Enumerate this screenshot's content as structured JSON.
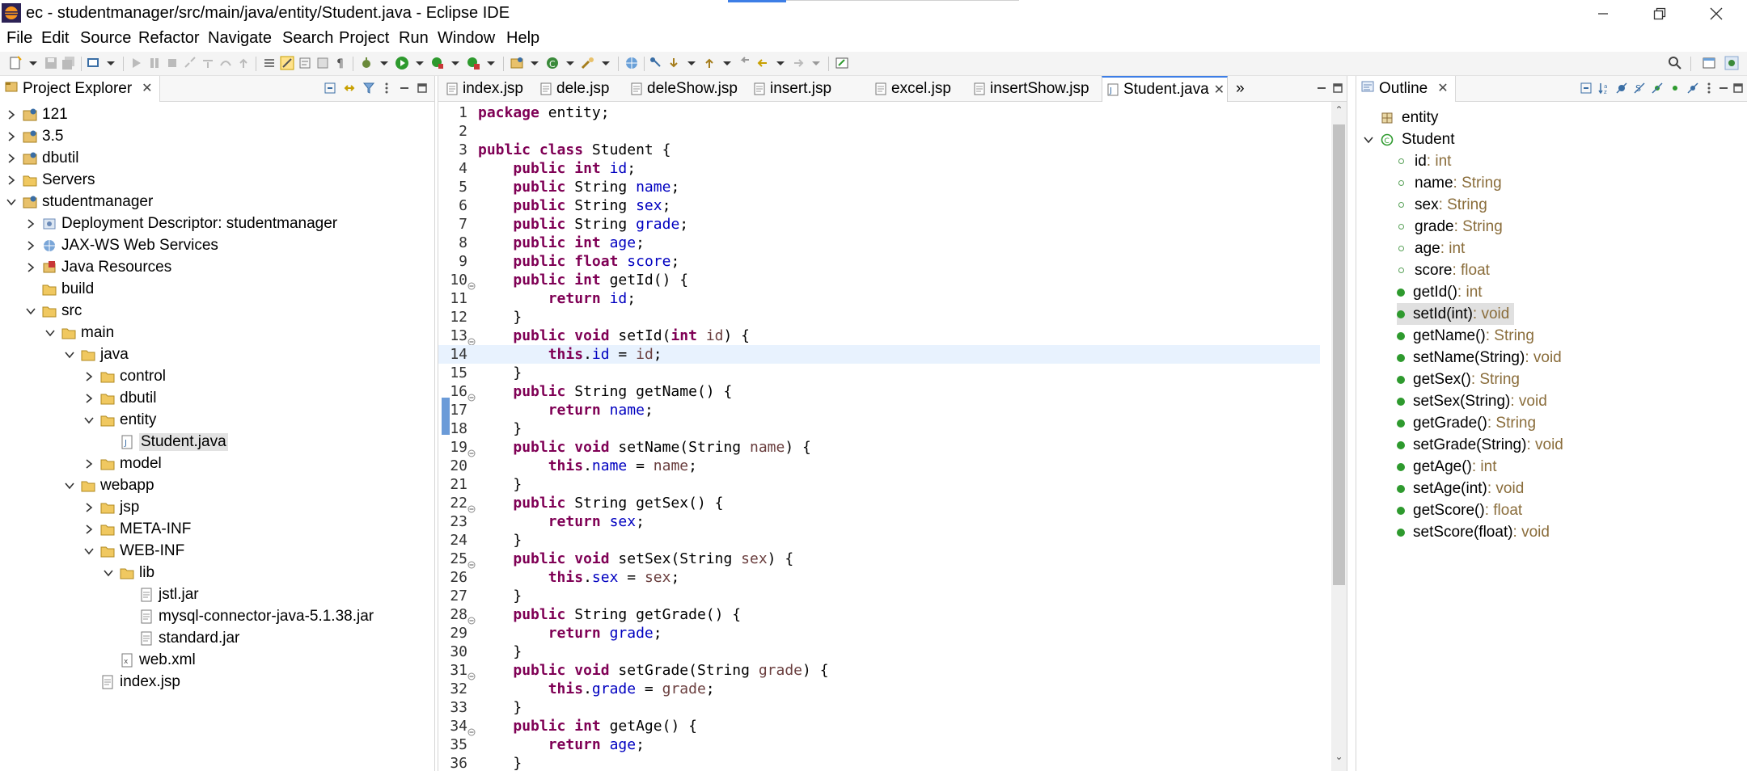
{
  "window": {
    "title": "ec - studentmanager/src/main/java/entity/Student.java - Eclipse IDE"
  },
  "menu": [
    "File",
    "Edit",
    "Source",
    "Refactor",
    "Navigate",
    "Search",
    "Project",
    "Run",
    "Window",
    "Help"
  ],
  "project_explorer": {
    "title": "Project Explorer",
    "items": [
      {
        "label": "121",
        "icon": "project-icon",
        "expanded": false
      },
      {
        "label": "3.5",
        "icon": "project-icon",
        "expanded": false
      },
      {
        "label": "dbutil",
        "icon": "project-icon",
        "expanded": false
      },
      {
        "label": "Servers",
        "icon": "folder-icon",
        "expanded": false
      },
      {
        "label": "studentmanager",
        "icon": "project-icon",
        "expanded": true
      },
      {
        "label": "Deployment Descriptor: studentmanager",
        "icon": "descriptor-icon",
        "expanded": false
      },
      {
        "label": "JAX-WS Web Services",
        "icon": "webservice-icon",
        "expanded": false
      },
      {
        "label": "Java Resources",
        "icon": "java-resources-icon",
        "expanded": false
      },
      {
        "label": "build",
        "icon": "folder-icon",
        "expanded": null
      },
      {
        "label": "src",
        "icon": "folder-icon",
        "expanded": true
      },
      {
        "label": "main",
        "icon": "folder-icon",
        "expanded": true
      },
      {
        "label": "java",
        "icon": "folder-icon",
        "expanded": true
      },
      {
        "label": "control",
        "icon": "folder-icon",
        "expanded": false
      },
      {
        "label": "dbutil",
        "icon": "folder-icon",
        "expanded": false
      },
      {
        "label": "entity",
        "icon": "folder-icon",
        "expanded": true
      },
      {
        "label": "Student.java",
        "icon": "java-file-icon",
        "expanded": null
      },
      {
        "label": "model",
        "icon": "folder-icon",
        "expanded": false
      },
      {
        "label": "webapp",
        "icon": "folder-icon",
        "expanded": true
      },
      {
        "label": "jsp",
        "icon": "folder-icon",
        "expanded": false
      },
      {
        "label": "META-INF",
        "icon": "folder-icon",
        "expanded": false
      },
      {
        "label": "WEB-INF",
        "icon": "folder-icon",
        "expanded": true
      },
      {
        "label": "lib",
        "icon": "folder-icon",
        "expanded": true
      },
      {
        "label": "jstl.jar",
        "icon": "jar-icon",
        "expanded": null
      },
      {
        "label": "mysql-connector-java-5.1.38.jar",
        "icon": "jar-icon",
        "expanded": null
      },
      {
        "label": "standard.jar",
        "icon": "jar-icon",
        "expanded": null
      },
      {
        "label": "web.xml",
        "icon": "xml-file-icon",
        "expanded": null
      },
      {
        "label": "index.jsp",
        "icon": "jsp-file-icon",
        "expanded": null
      }
    ]
  },
  "editor": {
    "tabs": [
      "index.jsp",
      "dele.jsp",
      "deleShow.jsp",
      "insert.jsp",
      "excel.jsp",
      "insertShow.jsp",
      "Student.java"
    ],
    "active_tab": "Student.java",
    "overflow_label": "»",
    "current_line": 14,
    "lines": [
      {
        "n": "1",
        "code": "package entity;"
      },
      {
        "n": "2",
        "code": ""
      },
      {
        "n": "3",
        "code": "public class Student {"
      },
      {
        "n": "4",
        "code": "    public int id;"
      },
      {
        "n": "5",
        "code": "    public String name;"
      },
      {
        "n": "6",
        "code": "    public String sex;"
      },
      {
        "n": "7",
        "code": "    public String grade;"
      },
      {
        "n": "8",
        "code": "    public int age;"
      },
      {
        "n": "9",
        "code": "    public float score;"
      },
      {
        "n": "10",
        "code": "    public int getId() {"
      },
      {
        "n": "11",
        "code": "        return id;"
      },
      {
        "n": "12",
        "code": "    }"
      },
      {
        "n": "13",
        "code": "    public void setId(int id) {"
      },
      {
        "n": "14",
        "code": "        this.id = id;"
      },
      {
        "n": "15",
        "code": "    }"
      },
      {
        "n": "16",
        "code": "    public String getName() {"
      },
      {
        "n": "17",
        "code": "        return name;"
      },
      {
        "n": "18",
        "code": "    }"
      },
      {
        "n": "19",
        "code": "    public void setName(String name) {"
      },
      {
        "n": "20",
        "code": "        this.name = name;"
      },
      {
        "n": "21",
        "code": "    }"
      },
      {
        "n": "22",
        "code": "    public String getSex() {"
      },
      {
        "n": "23",
        "code": "        return sex;"
      },
      {
        "n": "24",
        "code": "    }"
      },
      {
        "n": "25",
        "code": "    public void setSex(String sex) {"
      },
      {
        "n": "26",
        "code": "        this.sex = sex;"
      },
      {
        "n": "27",
        "code": "    }"
      },
      {
        "n": "28",
        "code": "    public String getGrade() {"
      },
      {
        "n": "29",
        "code": "        return grade;"
      },
      {
        "n": "30",
        "code": "    }"
      },
      {
        "n": "31",
        "code": "    public void setGrade(String grade) {"
      },
      {
        "n": "32",
        "code": "        this.grade = grade;"
      },
      {
        "n": "33",
        "code": "    }"
      },
      {
        "n": "34",
        "code": "    public int getAge() {"
      },
      {
        "n": "35",
        "code": "        return age;"
      },
      {
        "n": "36",
        "code": "    }"
      }
    ]
  },
  "outline": {
    "title": "Outline",
    "package": "entity",
    "class": "Student",
    "members": [
      {
        "name": "id",
        "type": " : int",
        "kind": "field"
      },
      {
        "name": "name",
        "type": " : String",
        "kind": "field"
      },
      {
        "name": "sex",
        "type": " : String",
        "kind": "field"
      },
      {
        "name": "grade",
        "type": " : String",
        "kind": "field"
      },
      {
        "name": "age",
        "type": " : int",
        "kind": "field"
      },
      {
        "name": "score",
        "type": " : float",
        "kind": "field"
      },
      {
        "name": "getId()",
        "type": " : int",
        "kind": "method"
      },
      {
        "name": "setId(int)",
        "type": " : void",
        "kind": "method",
        "selected": true
      },
      {
        "name": "getName()",
        "type": " : String",
        "kind": "method"
      },
      {
        "name": "setName(String)",
        "type": " : void",
        "kind": "method"
      },
      {
        "name": "getSex()",
        "type": " : String",
        "kind": "method"
      },
      {
        "name": "setSex(String)",
        "type": " : void",
        "kind": "method"
      },
      {
        "name": "getGrade()",
        "type": " : String",
        "kind": "method"
      },
      {
        "name": "setGrade(String)",
        "type": " : void",
        "kind": "method"
      },
      {
        "name": "getAge()",
        "type": " : int",
        "kind": "method"
      },
      {
        "name": "setAge(int)",
        "type": " : void",
        "kind": "method"
      },
      {
        "name": "getScore()",
        "type": " : float",
        "kind": "method"
      },
      {
        "name": "setScore(float)",
        "type": " : void",
        "kind": "method"
      }
    ]
  },
  "colors": {
    "keyword": "#7f0055",
    "field": "#0000c0",
    "parameter": "#6a3e3e",
    "current_line": "#e8f2fe",
    "field_dot": "#5aa25a",
    "method_dot": "#2e9a2e",
    "accent": "#3d7ee6"
  }
}
